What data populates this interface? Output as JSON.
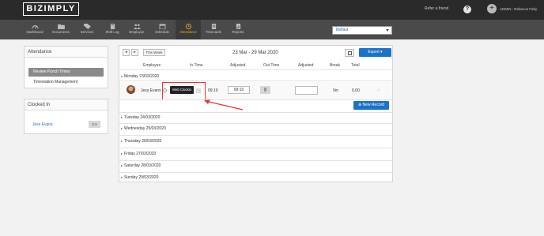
{
  "header": {
    "logo": "BIZIMPLY",
    "refer_link": "Refer a friend",
    "help_icon": "question-icon",
    "help_label": "?",
    "admin_icon": "plus-icon",
    "admin_label": "+",
    "admin_name": "ADMIN : Rebecca Fahy"
  },
  "nav": {
    "items": [
      {
        "label": "Dashboard",
        "icon": "dashboard-icon"
      },
      {
        "label": "Documents",
        "icon": "folder-icon"
      },
      {
        "label": "Services",
        "icon": "tag-icon"
      },
      {
        "label": "Shift Log",
        "icon": "book-icon"
      },
      {
        "label": "Employee",
        "icon": "people-icon"
      },
      {
        "label": "Schedule",
        "icon": "calendar-icon"
      },
      {
        "label": "Attendance",
        "icon": "clock-icon"
      },
      {
        "label": "Timecards",
        "icon": "card-icon"
      },
      {
        "label": "Reports",
        "icon": "report-icon"
      }
    ],
    "active": "Attendance",
    "location": "Belfast"
  },
  "sidebar": {
    "attendance_title": "Attendance",
    "items": [
      "Review Punch Times",
      "Timestation Management"
    ],
    "clocked_title": "Clocked In",
    "clocked_name": "Jess Evans",
    "clocked_value": "0.0"
  },
  "toolbar": {
    "prev": "◂",
    "next": "▸",
    "this_week": "This Week",
    "date_range": "23 Mar - 29 Mar 2020",
    "calendar_icon": "calendar-icon",
    "export": "Export ▾"
  },
  "table": {
    "headers": [
      "Employee",
      "In Time",
      "Adjusted",
      "Out Time",
      "Adjusted",
      "Break",
      "Total"
    ],
    "days": [
      "Monday 23/03/2020",
      "Tuesday 24/03/2020",
      "Wednesday 25/03/2020",
      "Thursday 26/03/2020",
      "Friday 27/03/2020",
      "Saturday 28/03/2020",
      "Sunday 29/03/2020"
    ],
    "row": {
      "name": "Jess Evans",
      "tooltip": "Web Clockin",
      "in_time": "09:10",
      "in_adjusted": "09:10",
      "out_adjusted": "",
      "break": "0m",
      "total": "0.00",
      "star": "☆"
    },
    "new_record": "⊕ New Record"
  },
  "colors": {
    "topbar": "#2a2a2a",
    "navbar": "#4a4a4a",
    "active_nav": "#f5a623",
    "primary": "#1a73c8",
    "annotation": "#e53935"
  }
}
